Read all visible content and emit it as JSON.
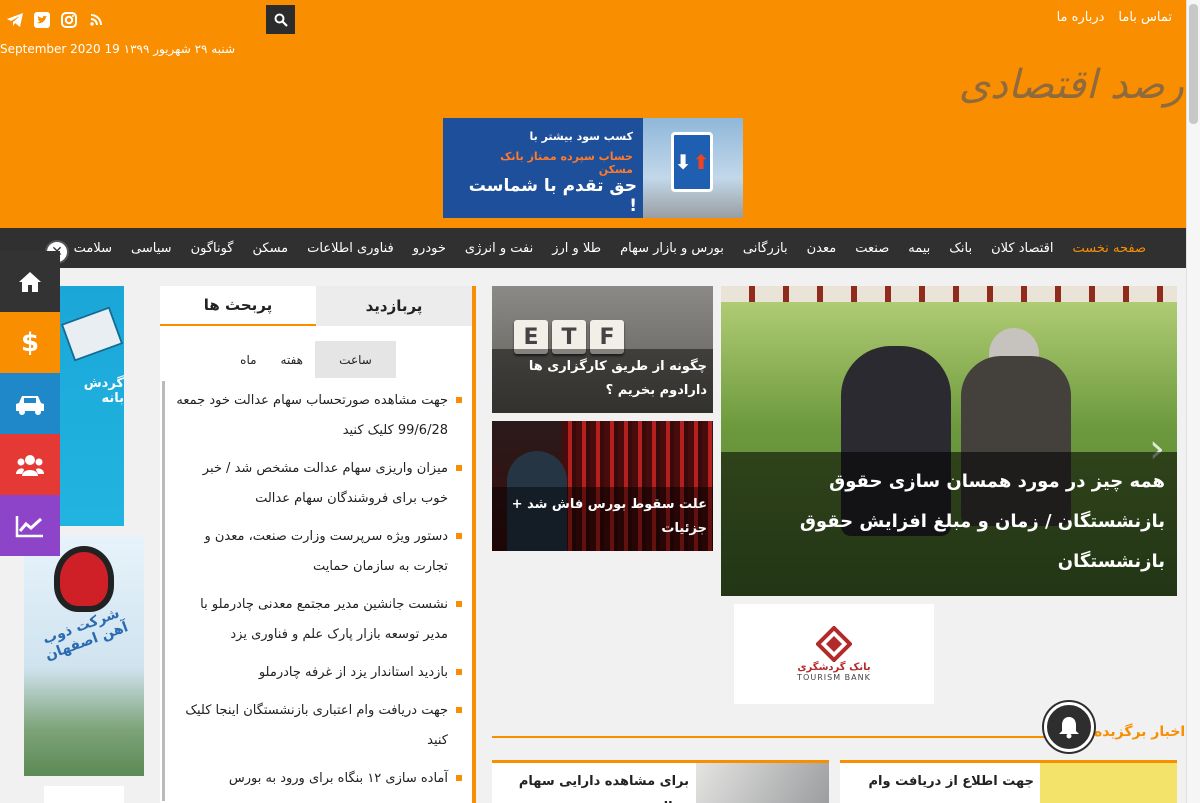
{
  "topnav": {
    "contact": "تماس باما",
    "about": "درباره ما"
  },
  "header": {
    "date": "شنبه ۲۹ شهریور ۱۳۹۹ 19 September 2020",
    "logo": "رصد اقتصادی"
  },
  "banner": {
    "line1": "کسب سود بیشتر با",
    "line2": "حساب سپرده ممتاز بانک مسکن",
    "line3": "حق تقدم با شماست !"
  },
  "mainnav": {
    "items": [
      "صفحه نخست",
      "اقتصاد کلان",
      "بانک",
      "بیمه",
      "صنعت",
      "معدن",
      "بازرگانی",
      "بورس و بازار سهام",
      "طلا و ارز",
      "نفت و انرژی",
      "خودرو",
      "فناوری اطلاعات",
      "مسکن",
      "گوناگون",
      "سیاسی",
      "سلامت"
    ]
  },
  "sidebar": {
    "colors": [
      "#333333",
      "#f88e00",
      "#1e88c9",
      "#e53935",
      "#8e44c9"
    ]
  },
  "ads": {
    "pos_text": "گردش بانه",
    "steel_text": "شرکت ذوب آهن اصفهان",
    "tourism_name": "بانک گردشگری",
    "tourism_en": "TOURISM BANK"
  },
  "tabbox": {
    "tab_popular": "پربازدید",
    "tab_discussed": "پربحث ها",
    "subtabs": [
      "ساعت",
      "هفته",
      "ماه"
    ],
    "items": [
      "جهت مشاهده صورتحساب سهام عدالت خود جمعه 99/6/28 کلیک کنید",
      "میزان واریزی سهام عدالت مشخص شد / خبر خوب برای فروشندگان سهام عدالت",
      "دستور ویژه سرپرست وزارت صنعت، معدن و تجارت به سازمان حمایت",
      "نشست جانشین مدیر مجتمع معدنی چادرملو با مدیر توسعه بازار پارک علم و فناوری یزد",
      "بازدید استاندار یزد از غرفه چادرملو",
      "جهت دریافت وام اعتباری بازنشستگان اینجا کلیک کنید",
      "آماده سازی ۱۲ بنگاه برای ورود به بورس"
    ]
  },
  "cards": {
    "etf_letters": [
      "E",
      "T",
      "F"
    ],
    "card1": "چگونه از طریق کارگزاری ها دارادوم بخریم ؟",
    "card2": "علت سقوط بورس فاش شد + جزئیات",
    "hero": "همه چیز در مورد همسان سازی حقوق بازنشستگان / زمان و مبلغ افزایش حقوق بازنشستگان"
  },
  "latest": {
    "title": "اخبار برگزیده",
    "card1": "برای مشاهده دارایی سهام عدالت",
    "card2": "جهت اطلاع از دریافت وام بدون"
  },
  "colors": {
    "accent": "#f88e00",
    "nav_bg": "#303030"
  }
}
